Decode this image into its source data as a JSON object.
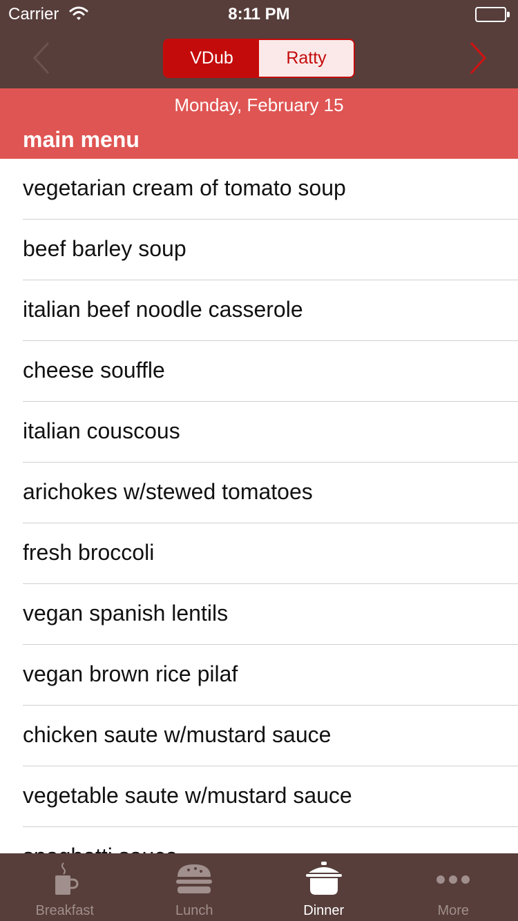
{
  "status_bar": {
    "carrier": "Carrier",
    "time": "8:11 PM"
  },
  "nav": {
    "segments": [
      "VDub",
      "Ratty"
    ],
    "selected_segment": "VDub",
    "prev_icon": "chevron-left-icon",
    "next_icon": "chevron-right-icon"
  },
  "header": {
    "date": "Monday, February 15",
    "section": "main menu"
  },
  "menu_items": [
    "vegetarian cream of tomato soup",
    "beef barley soup",
    "italian beef noodle casserole",
    "cheese souffle",
    "italian couscous",
    "arichokes w/stewed tomatoes",
    "fresh broccoli",
    "vegan spanish lentils",
    "vegan brown rice pilaf",
    "chicken saute w/mustard sauce",
    "vegetable saute w/mustard sauce",
    "spaghetti sauce"
  ],
  "tabs": [
    {
      "label": "Breakfast",
      "icon": "coffee-cup-icon"
    },
    {
      "label": "Lunch",
      "icon": "burger-icon"
    },
    {
      "label": "Dinner",
      "icon": "cooking-pot-icon"
    },
    {
      "label": "More",
      "icon": "more-dots-icon"
    }
  ],
  "selected_tab": "Dinner",
  "colors": {
    "nav_background": "#573e3b",
    "header_background": "#df5553",
    "accent": "#c40b0b"
  }
}
